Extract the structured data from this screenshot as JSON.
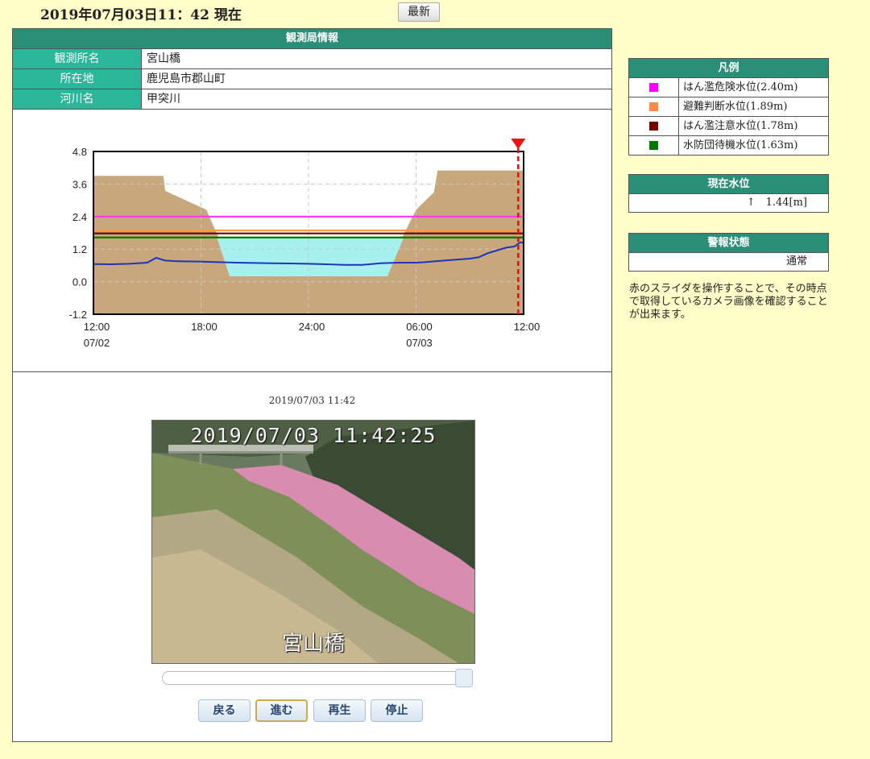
{
  "header": {
    "datetime": "2019年07月03日11：42 現在",
    "latest_label": "最新"
  },
  "station": {
    "title": "観測局情報",
    "rows": [
      {
        "label": "観測所名",
        "value": "宮山橋"
      },
      {
        "label": "所在地",
        "value": "鹿児島市郡山町"
      },
      {
        "label": "河川名",
        "value": "甲突川"
      }
    ]
  },
  "chart_data": {
    "type": "line",
    "yticks": [
      "4.8",
      "3.6",
      "2.4",
      "1.2",
      "0.0",
      "-1.2"
    ],
    "ylim": [
      -1.2,
      4.8
    ],
    "xticks": [
      {
        "t": 0,
        "time": "12:00",
        "date": "07/02"
      },
      {
        "t": 6,
        "time": "18:00",
        "date": ""
      },
      {
        "t": 12,
        "time": "24:00",
        "date": ""
      },
      {
        "t": 18,
        "time": "06:00",
        "date": "07/03"
      },
      {
        "t": 24,
        "time": "12:00",
        "date": ""
      }
    ],
    "grid": true,
    "thresholds": [
      {
        "value": 2.4,
        "color": "#ff33ff"
      },
      {
        "value": 1.89,
        "color": "#ff9944"
      },
      {
        "value": 1.78,
        "color": "#6b0000"
      },
      {
        "value": 1.63,
        "color": "#007a00"
      }
    ],
    "series": [
      {
        "color": "#2233bb",
        "x": [
          0,
          1,
          2,
          3,
          3.5,
          4,
          4.5,
          5,
          6,
          7,
          8,
          9,
          10,
          11,
          12,
          13,
          14,
          15,
          16,
          17,
          18,
          18.5,
          19,
          20,
          21,
          21.5,
          22,
          22.5,
          23,
          23.5,
          23.8,
          24
        ],
        "y": [
          0.65,
          0.64,
          0.66,
          0.7,
          0.88,
          0.78,
          0.76,
          0.75,
          0.74,
          0.72,
          0.7,
          0.69,
          0.68,
          0.67,
          0.66,
          0.64,
          0.62,
          0.62,
          0.68,
          0.7,
          0.7,
          0.72,
          0.75,
          0.8,
          0.85,
          0.9,
          1.05,
          1.15,
          1.25,
          1.3,
          1.45,
          1.44
        ]
      }
    ],
    "current_x": 23.7
  },
  "camera": {
    "time": "2019/07/03 11:42",
    "overlay_stamp": "2019/07/03 11:42:25",
    "overlay_name": "宮山橋",
    "slider_value": 1.0,
    "buttons": [
      "戻る",
      "進む",
      "再生",
      "停止"
    ]
  },
  "legend": {
    "title": "凡例",
    "items": [
      {
        "label": "はん濫危険水位(2.40m)",
        "color": "#ff00ff"
      },
      {
        "label": "避難判断水位(1.89m)",
        "color": "#ff8844"
      },
      {
        "label": "はん濫注意水位(1.78m)",
        "color": "#7a0000"
      },
      {
        "label": "水防団待機水位(1.63m)",
        "color": "#007a00"
      }
    ]
  },
  "current_level": {
    "title": "現在水位",
    "value": "↑　1.44[m]"
  },
  "warning": {
    "title": "警報状態",
    "value": "通常"
  },
  "note": "赤のスライダを操作することで、その時点で取得しているカメラ画像を確認することが出来ます。"
}
